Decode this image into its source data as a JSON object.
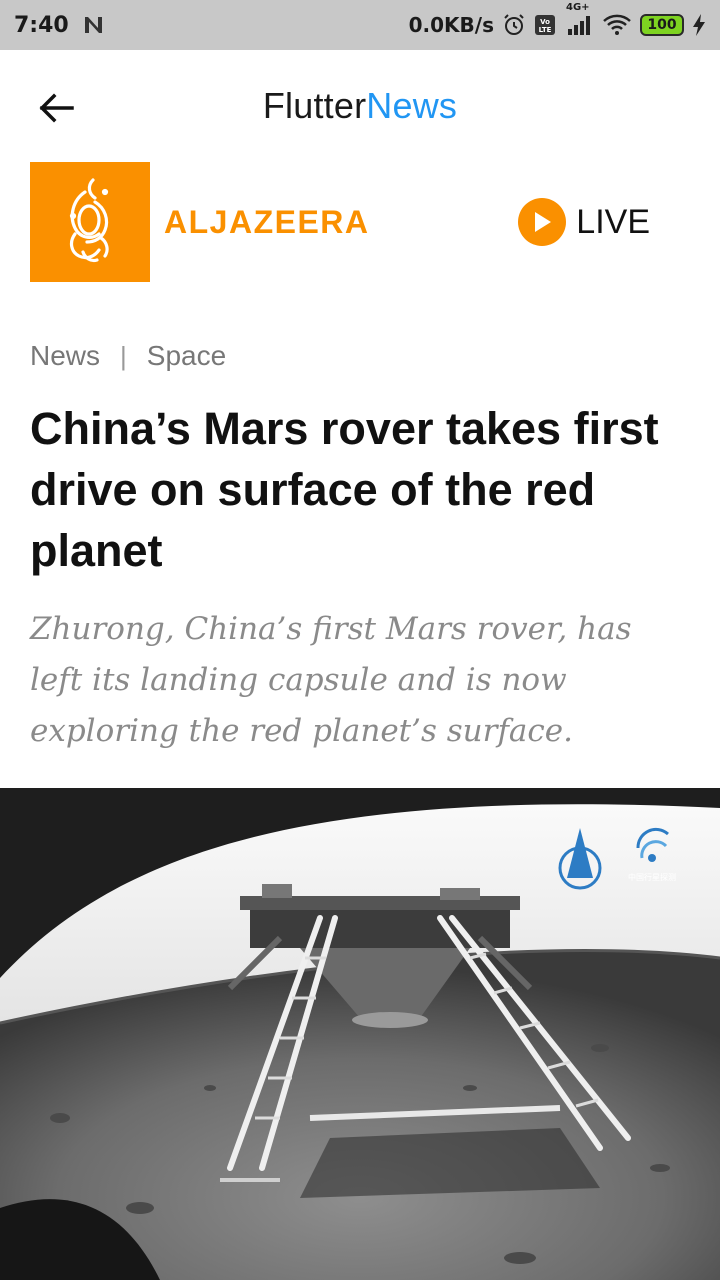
{
  "status_bar": {
    "time": "7:40",
    "notification_icon": "n-notification-icon",
    "net_speed": "0.0KB/s",
    "network_type": "4G+",
    "battery": "100"
  },
  "app_bar": {
    "back_icon": "arrow-back-icon",
    "title_part1": "Flutter",
    "title_part2": "News",
    "title_accent_color": "#2196f3"
  },
  "source": {
    "name": "ALJAZEERA",
    "brand_color": "#fa9000",
    "live_label": "LIVE",
    "live_icon": "play-icon"
  },
  "breadcrumb": {
    "section": "News",
    "separator": "|",
    "category": "Space"
  },
  "article": {
    "headline": "China’s Mars rover takes first drive on surface of the red planet",
    "summary": "Zhurong, China’s first Mars rover, has left its landing capsule and is now exploring the red planet’s surface.",
    "image_watermark": "中国行星探测"
  }
}
